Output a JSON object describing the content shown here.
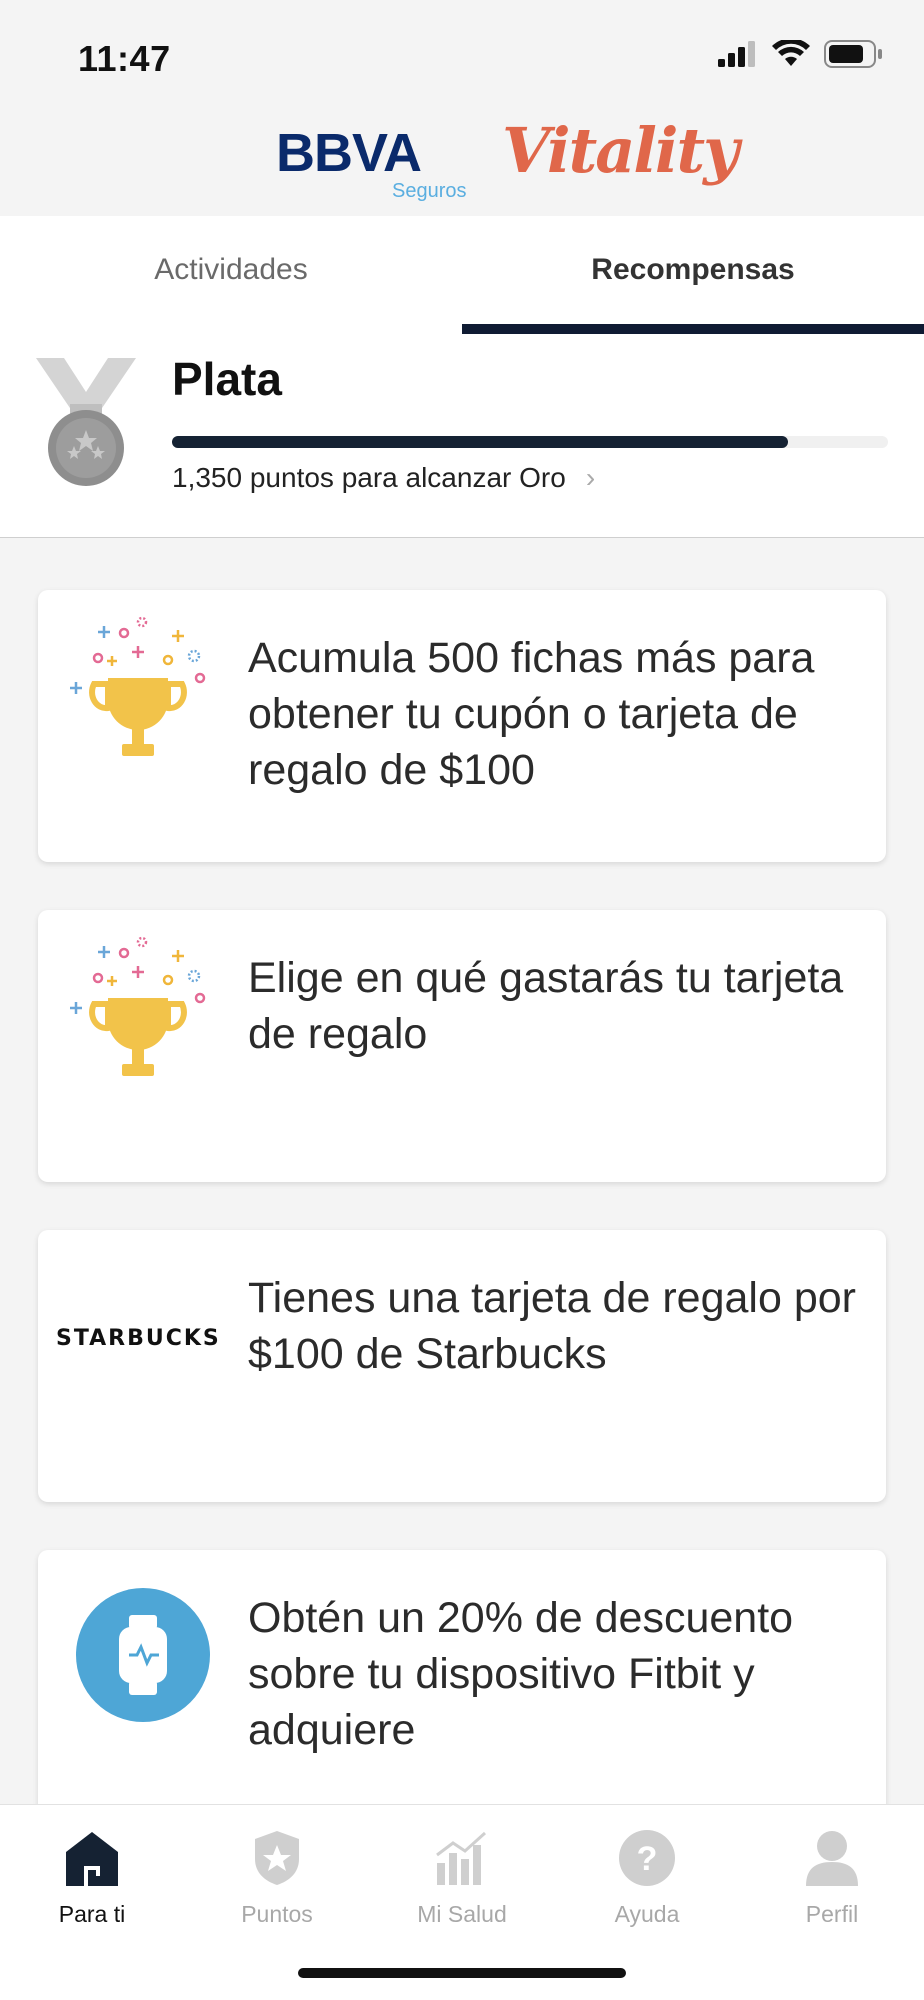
{
  "status_bar": {
    "time": "11:47"
  },
  "brand": {
    "bbva": "BBVA",
    "seguros": "Seguros",
    "vitality": "Vitality"
  },
  "tabs": [
    {
      "label": "Actividades",
      "active": false
    },
    {
      "label": "Recompensas",
      "active": true
    }
  ],
  "level": {
    "name": "Plata",
    "progress_fraction": 0.86,
    "subtitle": "1,350 puntos para alcanzar Oro"
  },
  "cards": [
    {
      "icon": "trophy-icon",
      "text": "Acumula 500 fichas más para obtener tu cupón o tarjeta de regalo de $100"
    },
    {
      "icon": "trophy-icon",
      "text": "Elige en qué gastarás tu tarjeta de regalo"
    },
    {
      "icon": "starbucks-logo",
      "logo_text": "STARBUCKS",
      "text": "Tienes una tarjeta de regalo por $100 de Starbucks"
    },
    {
      "icon": "smartwatch-icon",
      "text": "Obtén un 20% de descuento sobre tu dispositivo Fitbit y adquiere"
    }
  ],
  "bottom_nav": [
    {
      "label": "Para ti",
      "icon": "home-icon",
      "active": true
    },
    {
      "label": "Puntos",
      "icon": "badge-star-icon",
      "active": false
    },
    {
      "label": "Mi Salud",
      "icon": "chart-icon",
      "active": false
    },
    {
      "label": "Ayuda",
      "icon": "help-icon",
      "active": false
    },
    {
      "label": "Perfil",
      "icon": "profile-icon",
      "active": false
    }
  ]
}
